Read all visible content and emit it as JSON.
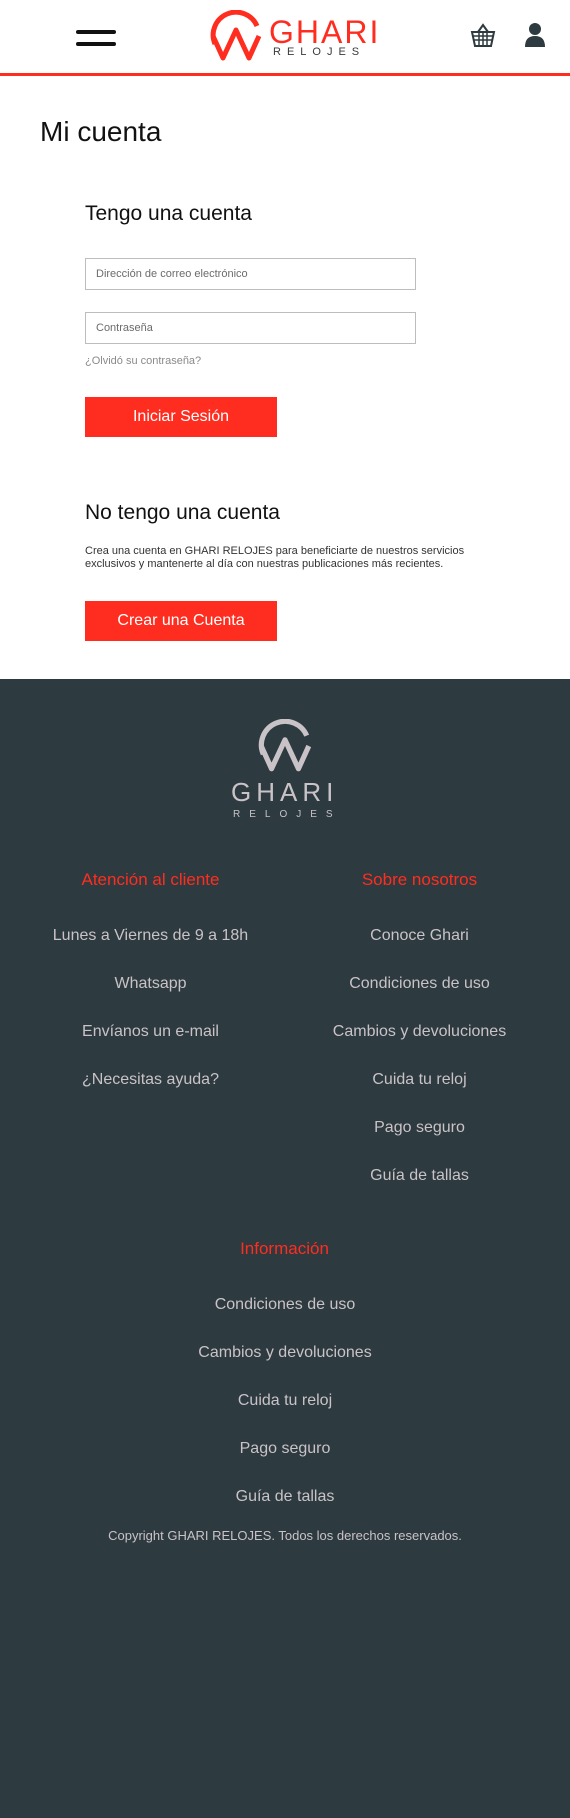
{
  "colors": {
    "accent": "#ff2d1f",
    "footer_bg": "#2d3a3f",
    "footer_text": "#c9c3c8"
  },
  "header": {
    "menu_icon": "hamburger-icon",
    "logo_text": "GHARI",
    "logo_subtext": "RELOJES",
    "cart_icon": "basket-icon",
    "user_icon": "user-icon"
  },
  "main": {
    "title": "Mi cuenta",
    "login": {
      "heading": "Tengo una cuenta",
      "email_placeholder": "Dirección de correo electrónico",
      "password_placeholder": "Contraseña",
      "forgot_label": "¿Olvidó su contraseña?",
      "submit_label": "Iniciar Sesión"
    },
    "register": {
      "heading": "No tengo una cuenta",
      "description": "Crea una cuenta en GHARI RELOJES para beneficiarte de nuestros servicios exclusivos y mantenerte al día con nuestras publicaciones más recientes.",
      "button_label": "Crear una Cuenta"
    }
  },
  "footer": {
    "logo_text": "GHARI",
    "logo_subtext": "RELOJES",
    "customer": {
      "title": "Atención al cliente",
      "links": [
        "Lunes a Viernes de 9 a 18h",
        "Whatsapp",
        "Envíanos un e-mail",
        "¿Necesitas ayuda?"
      ]
    },
    "about": {
      "title": "Sobre nosotros",
      "links": [
        "Conoce Ghari",
        "Condiciones de uso",
        "Cambios y devoluciones",
        "Cuida tu reloj",
        "Pago seguro",
        "Guía de tallas"
      ]
    },
    "info": {
      "title": "Información",
      "links": [
        "Condiciones de uso",
        "Cambios y devoluciones",
        "Cuida tu reloj",
        "Pago seguro",
        "Guía de tallas"
      ]
    },
    "copyright": "Copyright GHARI RELOJES. Todos los derechos reservados."
  }
}
